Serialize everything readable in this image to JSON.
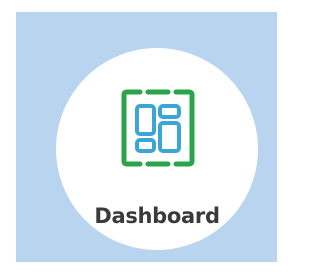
{
  "tile": {
    "label": "Dashboard",
    "icon": "dashboard-icon"
  },
  "colors": {
    "background": "#b9d4ee",
    "tile": "#ffffff",
    "icon_frame": "#2aa44a",
    "icon_panels": "#3aa6d8",
    "label_text": "#3a3a3a"
  }
}
